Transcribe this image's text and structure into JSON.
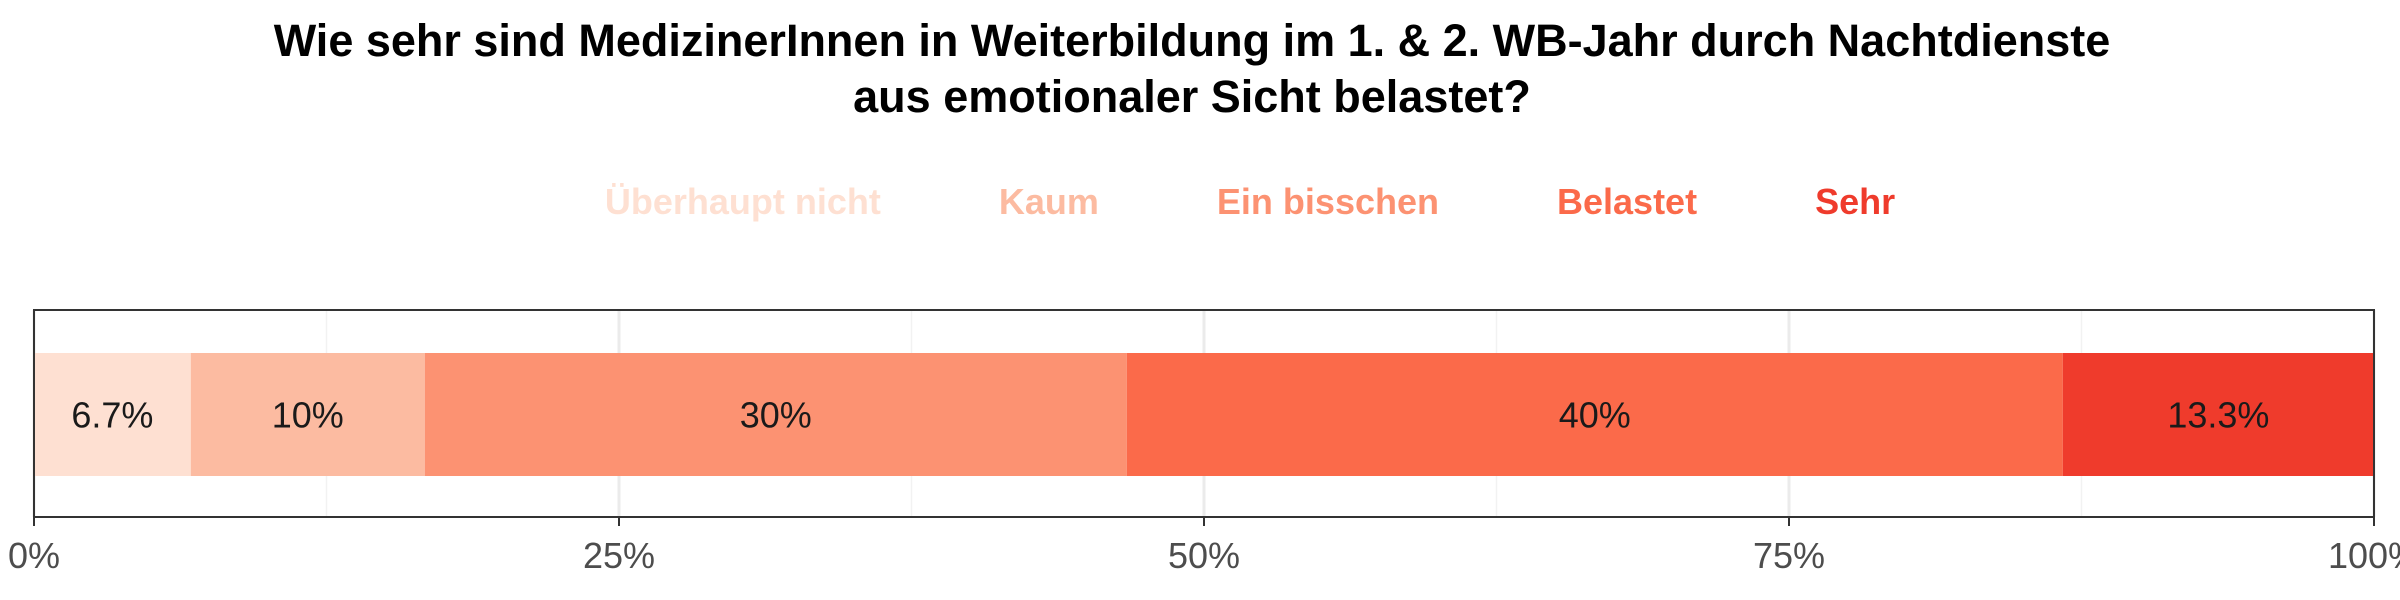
{
  "chart_data": {
    "type": "bar",
    "orientation": "horizontal",
    "stacked": true,
    "title": "Wie sehr sind MedizinerInnen in Weiterbildung im 1. & 2. WB-Jahr durch Nachtdienste aus emotionaler Sicht belastet?",
    "title_lines": [
      "Wie sehr sind MedizinerInnen in Weiterbildung im 1. & 2. WB-Jahr durch Nachtdienste",
      "aus emotionaler Sicht belastet?"
    ],
    "xlabel": "",
    "ylabel": "",
    "xlim": [
      0,
      100
    ],
    "x_ticks": [
      0,
      25,
      50,
      75,
      100
    ],
    "x_tick_labels": [
      "0%",
      "25%",
      "50%",
      "75%",
      "100%"
    ],
    "grid": true,
    "legend_position": "top",
    "series": [
      {
        "name": "Überhaupt nicht",
        "value": 6.7,
        "label": "6.7%",
        "color": "#FEE0D2"
      },
      {
        "name": "Kaum",
        "value": 10,
        "label": "10%",
        "color": "#FCBBA1"
      },
      {
        "name": "Ein bisschen",
        "value": 30,
        "label": "30%",
        "color": "#FC9272"
      },
      {
        "name": "Belastet",
        "value": 40,
        "label": "40%",
        "color": "#FB6A4A"
      },
      {
        "name": "Sehr",
        "value": 13.3,
        "label": "13.3%",
        "color": "#EF3B2C"
      }
    ]
  }
}
